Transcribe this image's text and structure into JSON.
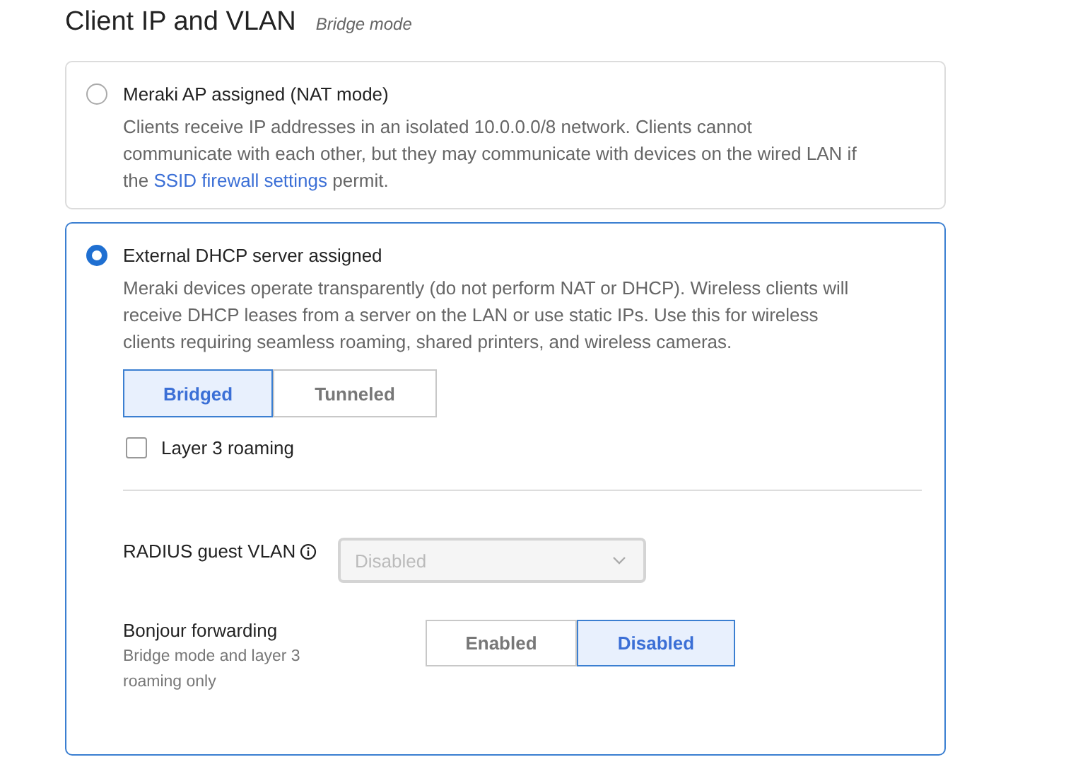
{
  "header": {
    "title": "Client IP and VLAN",
    "subtitle": "Bridge mode"
  },
  "options": [
    {
      "label": "Meraki AP assigned (NAT mode)",
      "selected": false,
      "description": "Clients receive IP addresses in an isolated 10.0.0.0/8 network. Clients cannot communicate with each other, but they may communicate with devices on the wired LAN if the ",
      "link": "SSID firewall settings",
      "description_end": " permit."
    },
    {
      "label": "External DHCP server assigned",
      "selected": true,
      "description": "Meraki devices operate transparently (do not perform NAT or DHCP). Wireless clients will receive DHCP leases from a server on the LAN or use static IPs. Use this for wireless clients requiring seamless roaming, shared printers, and wireless cameras.",
      "mode_toggle": [
        {
          "label": "Bridged",
          "selected": true
        },
        {
          "label": "Tunneled",
          "selected": false
        }
      ],
      "layer3_roaming": {
        "label": "Layer 3 roaming",
        "checked": false
      },
      "radius_guest_vlan": {
        "label": "RADIUS guest VLAN",
        "value": "Disabled",
        "disabled": true
      },
      "bonjour_forwarding": {
        "label": "Bonjour forwarding",
        "note": "Bridge mode and layer 3 roaming only",
        "toggle": [
          {
            "label": "Enabled",
            "selected": false
          },
          {
            "label": "Disabled",
            "selected": true
          }
        ]
      }
    }
  ]
}
